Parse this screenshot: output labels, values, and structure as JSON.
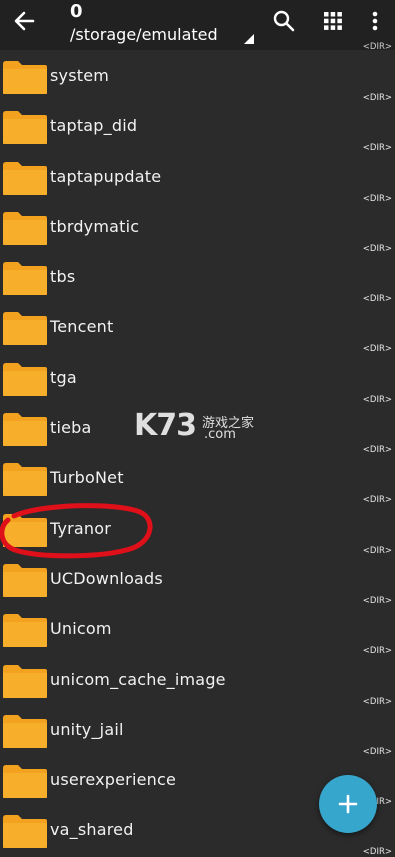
{
  "toolbar": {
    "count": "0",
    "path": "/storage/emulated",
    "top_right_tag": "<DIR>"
  },
  "files": [
    {
      "name": "system",
      "tag": "<DIR>"
    },
    {
      "name": "taptap_did",
      "tag": "<DIR>"
    },
    {
      "name": "taptapupdate",
      "tag": "<DIR>"
    },
    {
      "name": "tbrdymatic",
      "tag": "<DIR>"
    },
    {
      "name": "tbs",
      "tag": "<DIR>"
    },
    {
      "name": "Tencent",
      "tag": "<DIR>"
    },
    {
      "name": "tga",
      "tag": "<DIR>"
    },
    {
      "name": "tieba",
      "tag": "<DIR>"
    },
    {
      "name": "TurboNet",
      "tag": "<DIR>"
    },
    {
      "name": "Tyranor",
      "tag": "<DIR>"
    },
    {
      "name": "UCDownloads",
      "tag": "<DIR>"
    },
    {
      "name": "Unicom",
      "tag": "<DIR>"
    },
    {
      "name": "unicom_cache_image",
      "tag": "<DIR>"
    },
    {
      "name": "unity_jail",
      "tag": "<DIR>"
    },
    {
      "name": "userexperience",
      "tag": "<DIR>"
    },
    {
      "name": "va_shared",
      "tag": "<DIR>"
    }
  ],
  "watermark": {
    "logo": "K73",
    "cn_text": "游戏之家",
    "domain": ".com"
  },
  "icons": {
    "back": "arrow-back-icon",
    "search": "search-icon",
    "grid": "grid-view-icon",
    "more": "more-vertical-icon",
    "folder": "folder-icon",
    "fab": "plus-icon"
  },
  "colors": {
    "background": "#2b2b2b",
    "toolbar": "#212121",
    "folder": "#f5a623",
    "fab": "#36a6cc",
    "highlight_circle": "#e0101a"
  }
}
